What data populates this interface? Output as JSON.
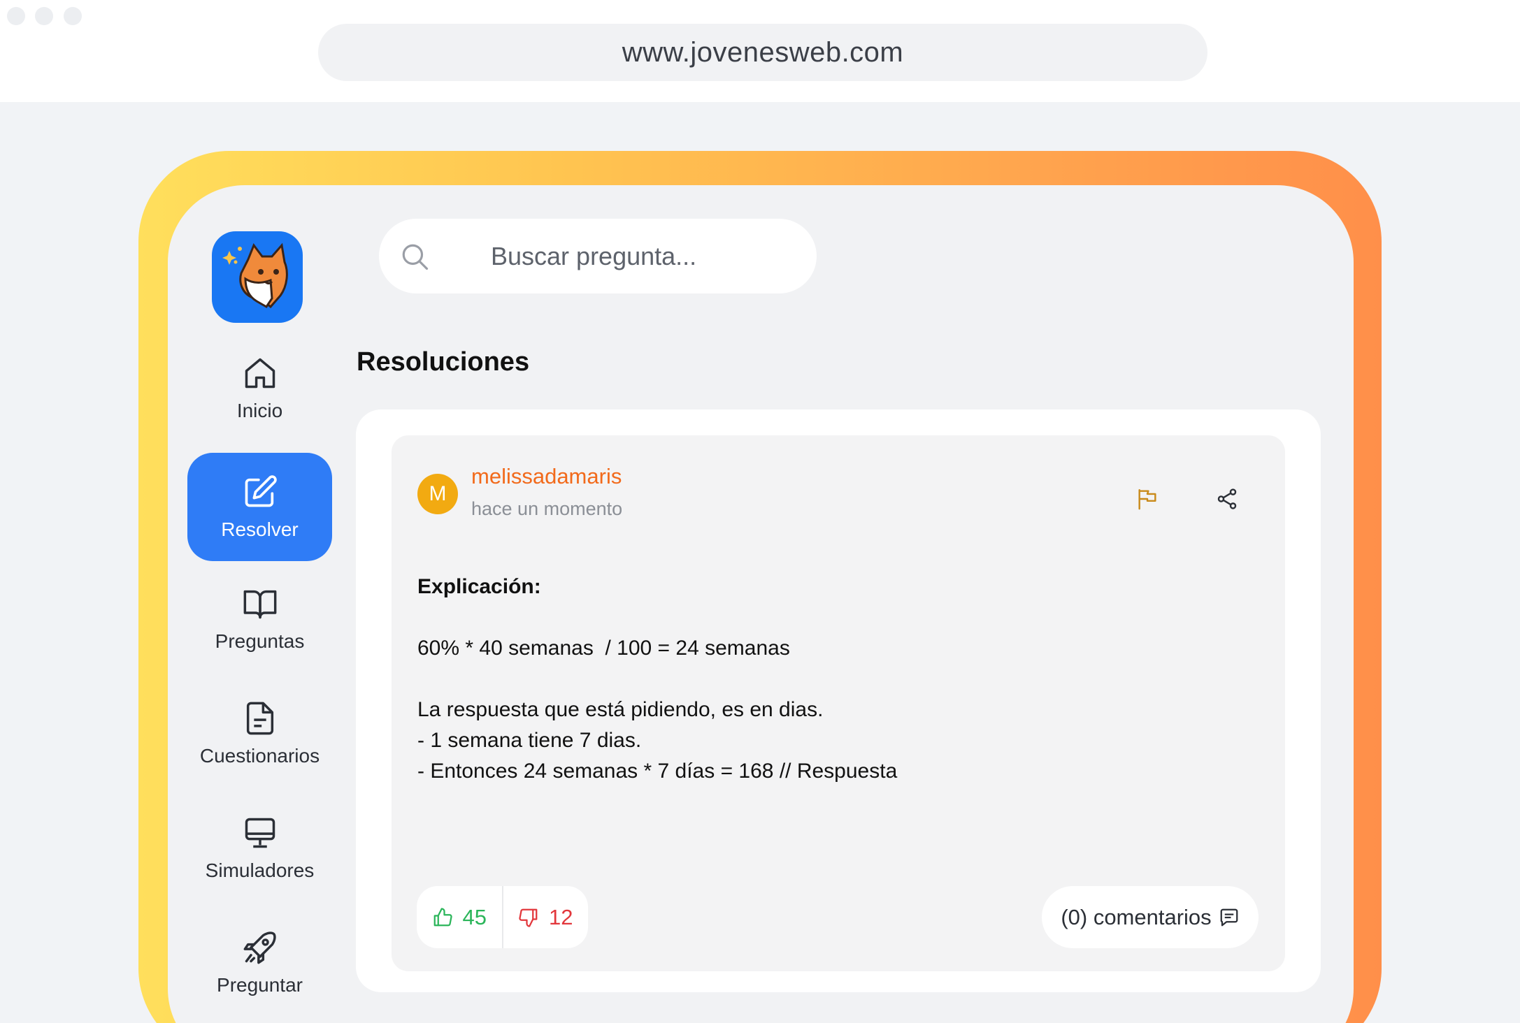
{
  "browser": {
    "url": "www.jovenesweb.com"
  },
  "sidebar": {
    "logo_icon": "fox-mascot-icon",
    "items": [
      {
        "label": "Inicio",
        "icon": "home-icon",
        "active": false
      },
      {
        "label": "Resolver",
        "icon": "edit-icon",
        "active": true
      },
      {
        "label": "Preguntas",
        "icon": "book-icon",
        "active": false
      },
      {
        "label": "Cuestionarios",
        "icon": "document-icon",
        "active": false
      },
      {
        "label": "Simuladores",
        "icon": "monitor-icon",
        "active": false
      },
      {
        "label": "Preguntar",
        "icon": "rocket-icon",
        "active": false
      }
    ]
  },
  "search": {
    "placeholder": "Buscar pregunta..."
  },
  "main": {
    "title": "Resoluciones",
    "answer": {
      "avatar_letter": "M",
      "username": "melissadamaris",
      "timestamp": "hace un momento",
      "heading": "Explicación:",
      "lines": [
        "60% * 40 semanas  / 100 = 24 semanas",
        "La respuesta que está pidiendo, es en dias.",
        "- 1 semana tiene 7 dias.",
        "- Entonces 24 semanas * 7 días = 168 // Respuesta"
      ],
      "likes": "45",
      "dislikes": "12",
      "comments_label": "(0) comentarios"
    }
  },
  "colors": {
    "accent_blue": "#2f7cf6",
    "username_orange": "#f26a1b",
    "like_green": "#2bb55a",
    "dislike_red": "#e2373c",
    "gradient_start": "#ffdf5c",
    "gradient_end": "#ff8f4a"
  }
}
